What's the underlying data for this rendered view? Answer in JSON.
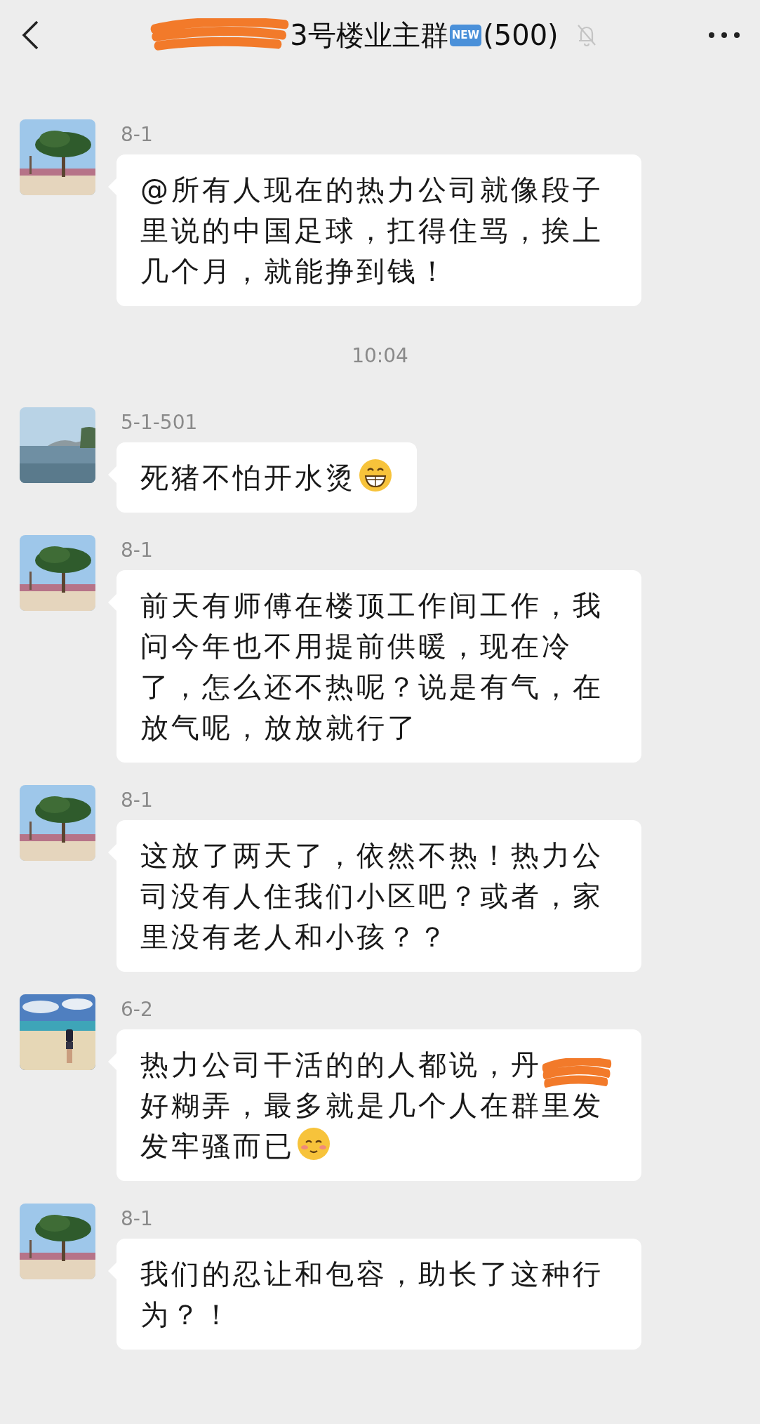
{
  "header": {
    "title": "3号楼业主群",
    "title_redacted": true,
    "badge": "NEW",
    "member_count": "(500)",
    "muted": true
  },
  "messages": [
    {
      "kind": "message",
      "sender": "8-1",
      "text": "@所有人现在的热力公司就像段子里说的中国足球，扛得住骂，挨上几个月，就能挣到钱！"
    },
    {
      "kind": "time",
      "text": "10:04"
    },
    {
      "kind": "message",
      "sender": "5-1-501",
      "text": "死猪不怕开水烫",
      "trailing_emoji": {
        "kind": "grin"
      }
    },
    {
      "kind": "message",
      "sender": "8-1",
      "text": "前天有师傅在楼顶工作间工作，我问今年也不用提前供暖，现在冷了，怎么还不热呢？说是有气，在放气呢，放放就行了"
    },
    {
      "kind": "message",
      "sender": "8-1",
      "text": "这放了两天了，依然不热！热力公司没有人住我们小区吧？或者，家里没有老人和小孩？？"
    },
    {
      "kind": "message",
      "sender": "6-2",
      "text": "热力公司干活的的人都说，丹",
      "redacted": true,
      "text_after": "好糊弄，最多就是几个人在群里发发牢骚而已",
      "trailing_emoji": {
        "kind": "blush"
      }
    },
    {
      "kind": "message",
      "sender": "8-1",
      "text": "我们的忍让和包容，助长了这种行为？！"
    }
  ]
}
